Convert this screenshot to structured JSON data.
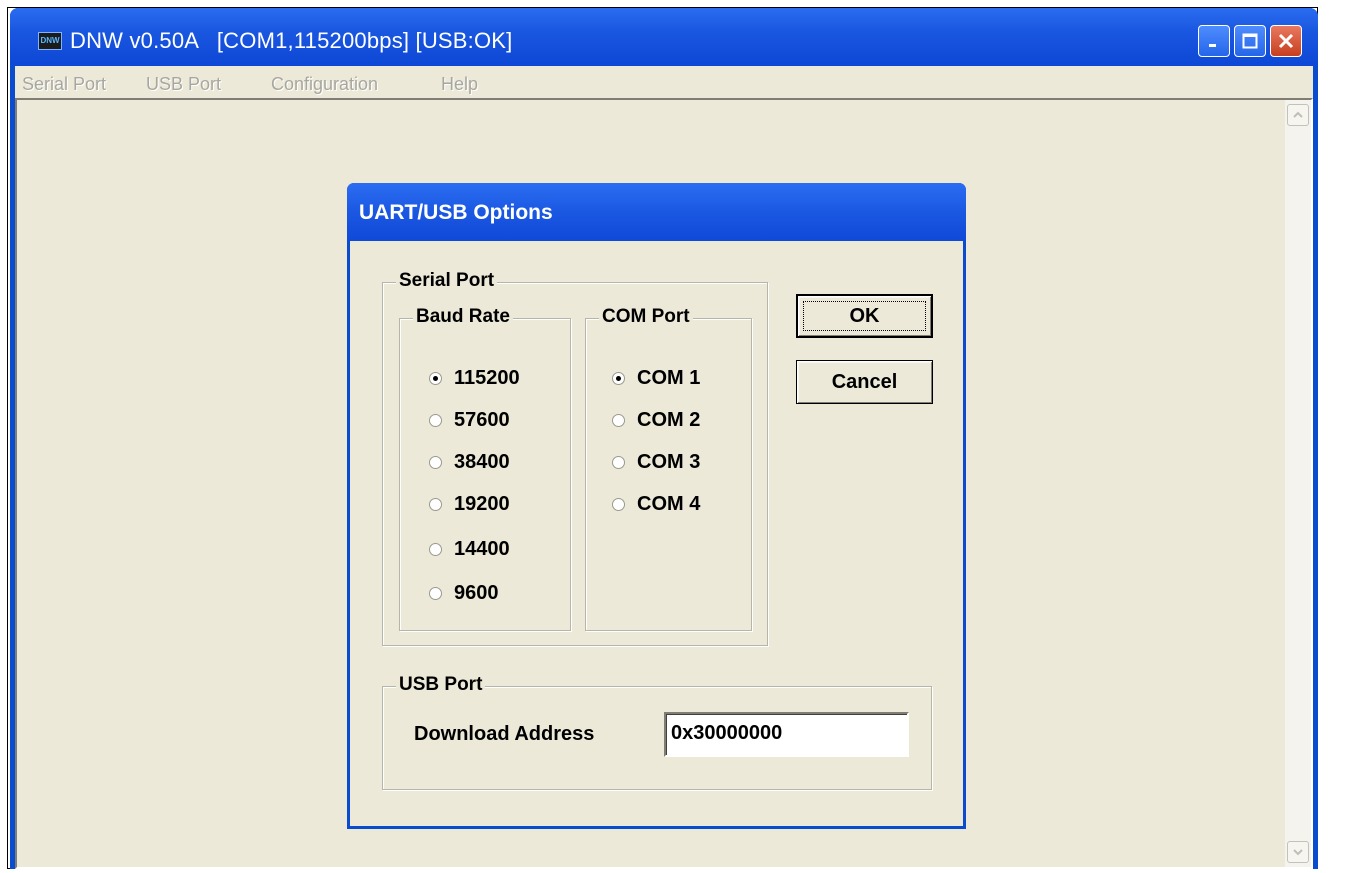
{
  "window": {
    "title": "DNW v0.50A   [COM1,115200bps] [USB:OK]",
    "icon_text": "DNW",
    "controls": {
      "minimize": "minimize-icon",
      "maximize": "maximize-icon",
      "close": "close-icon"
    }
  },
  "menubar": {
    "items": [
      "Serial Port",
      "USB Port",
      "Configuration",
      "Help"
    ]
  },
  "dialog": {
    "title": "UART/USB Options",
    "serial_port": {
      "label": "Serial Port",
      "baud_rate": {
        "label": "Baud Rate",
        "options": [
          "115200",
          "57600",
          "38400",
          "19200",
          "14400",
          "9600"
        ],
        "selected": "115200"
      },
      "com_port": {
        "label": "COM Port",
        "options": [
          "COM 1",
          "COM 2",
          "COM 3",
          "COM 4"
        ],
        "selected": "COM 1"
      }
    },
    "usb_port": {
      "label": "USB Port",
      "download_address_label": "Download Address",
      "download_address_value": "0x30000000"
    },
    "ok_label": "OK",
    "cancel_label": "Cancel"
  },
  "colors": {
    "titlebar": "#0a4ccf",
    "face": "#ece9d8"
  }
}
